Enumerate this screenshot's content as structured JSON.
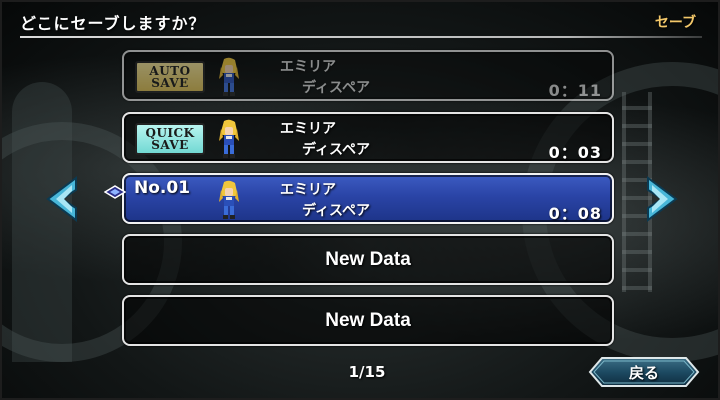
{
  "header": {
    "title": "どこにセーブしますか？",
    "mode": "セーブ"
  },
  "slots": [
    {
      "badge_line1": "AUTO",
      "badge_line2": "SAVE",
      "character": "エミリア",
      "location": "ディスペア",
      "playtime": "0：11"
    },
    {
      "badge_line1": "QUICK",
      "badge_line2": "SAVE",
      "character": "エミリア",
      "location": "ディスペア",
      "playtime": "0：03"
    },
    {
      "number": "No.01",
      "character": "エミリア",
      "location": "ディスペア",
      "playtime": "0：08"
    },
    {
      "empty_label": "New Data"
    },
    {
      "empty_label": "New Data"
    }
  ],
  "pagination": {
    "current": 1,
    "total": 15,
    "label": "1/15"
  },
  "back_button": {
    "label": "戻る"
  },
  "icons": {
    "prev": "chevron-left-icon",
    "next": "chevron-right-icon",
    "cursor": "diamond-cursor-icon",
    "sprite": "character-sprite"
  },
  "colors": {
    "selected_bg": "#2a44a6",
    "accent_cyan": "#3fa8c8",
    "auto_badge": "#d9bb52",
    "quick_badge": "#72d9d3",
    "mode_label": "#f3c86a"
  }
}
